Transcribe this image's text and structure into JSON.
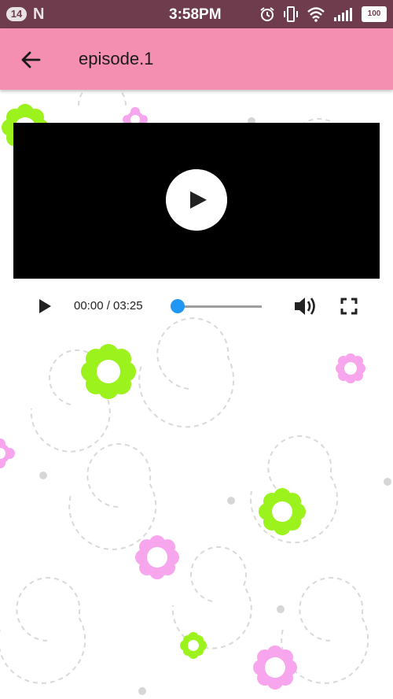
{
  "status_bar": {
    "notification_count": "14",
    "clock": "3:58PM",
    "battery": "100"
  },
  "app_bar": {
    "title": "episode.1"
  },
  "player": {
    "time": "00:00 / 03:25",
    "seek_fraction": 0.0
  },
  "colors": {
    "status_bar": "#6e3c4d",
    "app_bar": "#f48fb1",
    "seek_accent": "#2196f3",
    "flower_green": "#9cf21c",
    "flower_pink": "#f7a6ee"
  }
}
